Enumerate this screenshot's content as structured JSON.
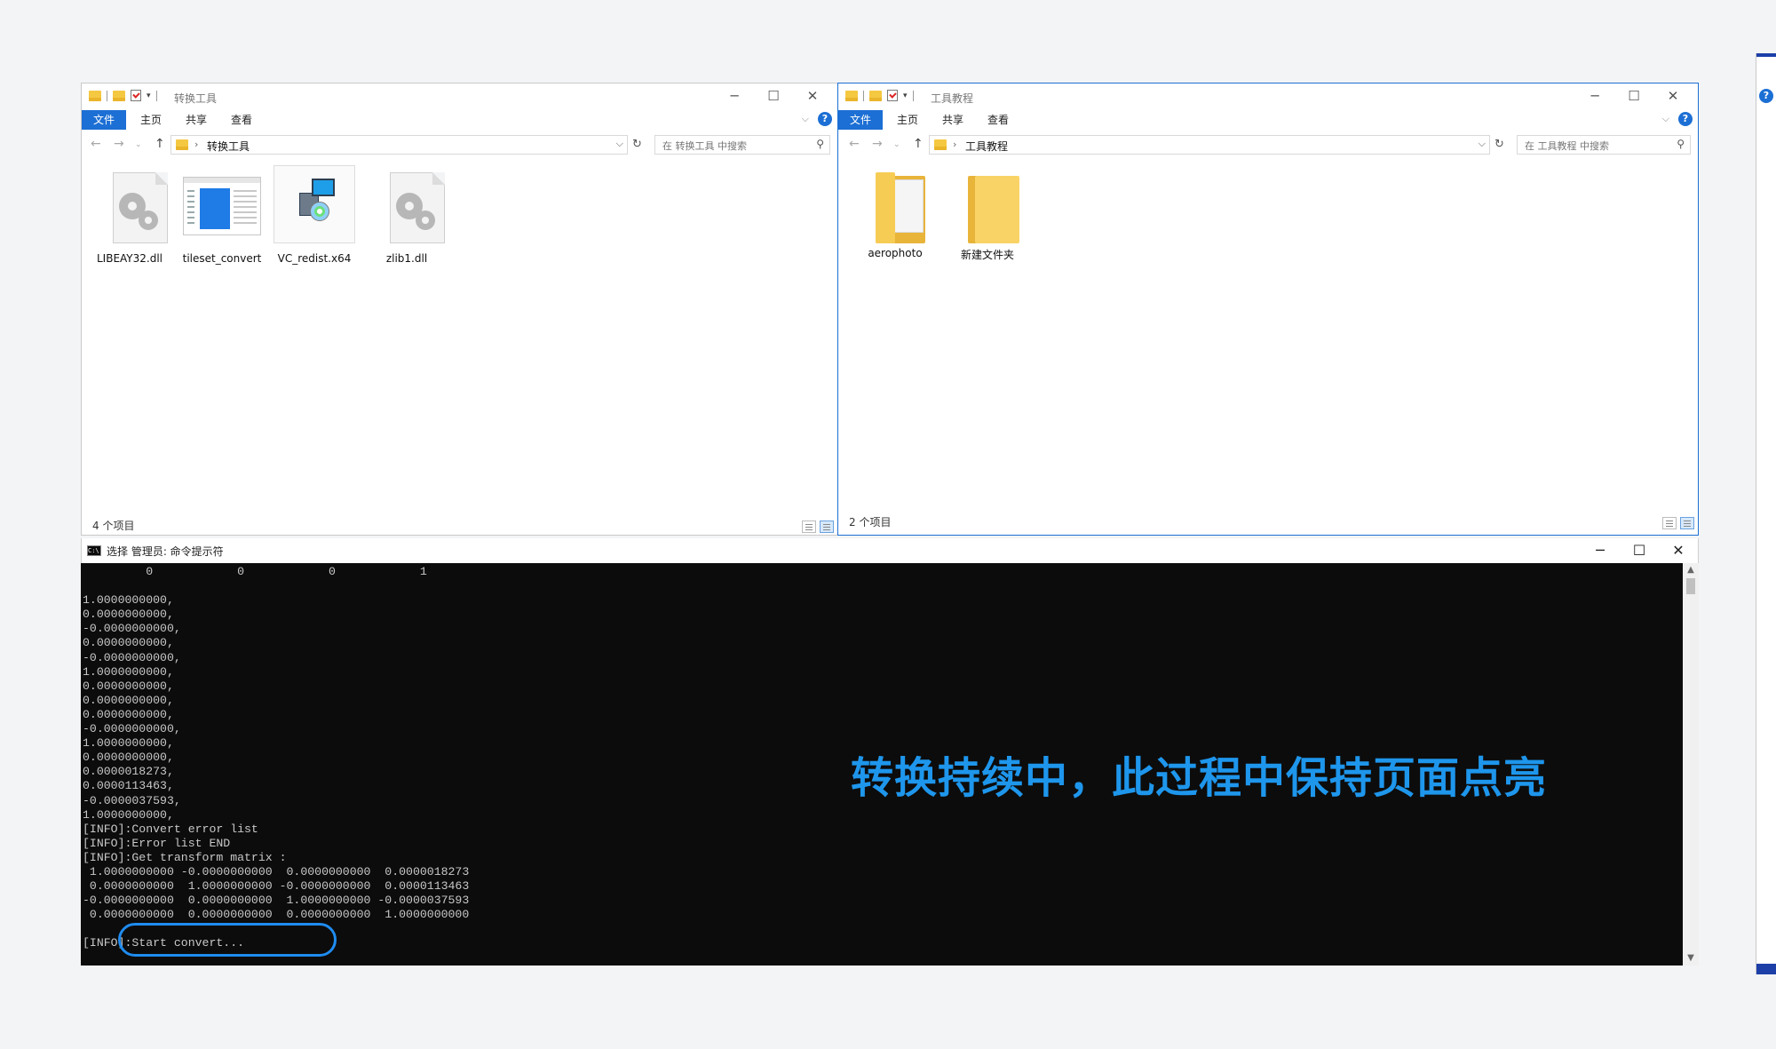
{
  "explorer_left": {
    "title": "转换工具",
    "ribbon": {
      "file": "文件",
      "home": "主页",
      "share": "共享",
      "view": "查看"
    },
    "address": "转换工具",
    "search_placeholder": "在 转换工具 中搜索",
    "files": [
      {
        "name": "LIBEAY32.dll",
        "icon": "dll-gear-icon"
      },
      {
        "name": "tileset_convert",
        "icon": "application-icon"
      },
      {
        "name": "VC_redist.x64",
        "icon": "installer-icon"
      },
      {
        "name": "zlib1.dll",
        "icon": "dll-gear-icon"
      }
    ],
    "status": "4 个项目"
  },
  "explorer_right": {
    "title": "工具教程",
    "ribbon": {
      "file": "文件",
      "home": "主页",
      "share": "共享",
      "view": "查看"
    },
    "address": "工具教程",
    "search_placeholder": "在 工具教程 中搜索",
    "files": [
      {
        "name": "aerophoto",
        "icon": "folder-with-files-icon"
      },
      {
        "name": "新建文件夹",
        "icon": "folder-icon"
      }
    ],
    "status": "2 个项目"
  },
  "cmd": {
    "title": "选择 管理员: 命令提示符",
    "lines": [
      "         0            0            0            1",
      "",
      "1.0000000000,",
      "0.0000000000,",
      "-0.0000000000,",
      "0.0000000000,",
      "-0.0000000000,",
      "1.0000000000,",
      "0.0000000000,",
      "0.0000000000,",
      "0.0000000000,",
      "-0.0000000000,",
      "1.0000000000,",
      "0.0000000000,",
      "0.0000018273,",
      "0.0000113463,",
      "-0.0000037593,",
      "1.0000000000,",
      "[INFO]:Convert error list",
      "[INFO]:Error list END",
      "[INFO]:Get transform matrix :",
      " 1.0000000000 -0.0000000000  0.0000000000  0.0000018273",
      " 0.0000000000  1.0000000000 -0.0000000000  0.0000113463",
      "-0.0000000000  0.0000000000  1.0000000000 -0.0000037593",
      " 0.0000000000  0.0000000000  0.0000000000  1.0000000000",
      "",
      "[INFO]:Start convert..."
    ]
  },
  "annotation": "转换持续中，此过程中保持页面点亮",
  "colors": {
    "accent": "#1c6fd4",
    "annotation": "#1e96ec",
    "console_bg": "#0c0c0c",
    "console_text": "#c8c8c8"
  }
}
